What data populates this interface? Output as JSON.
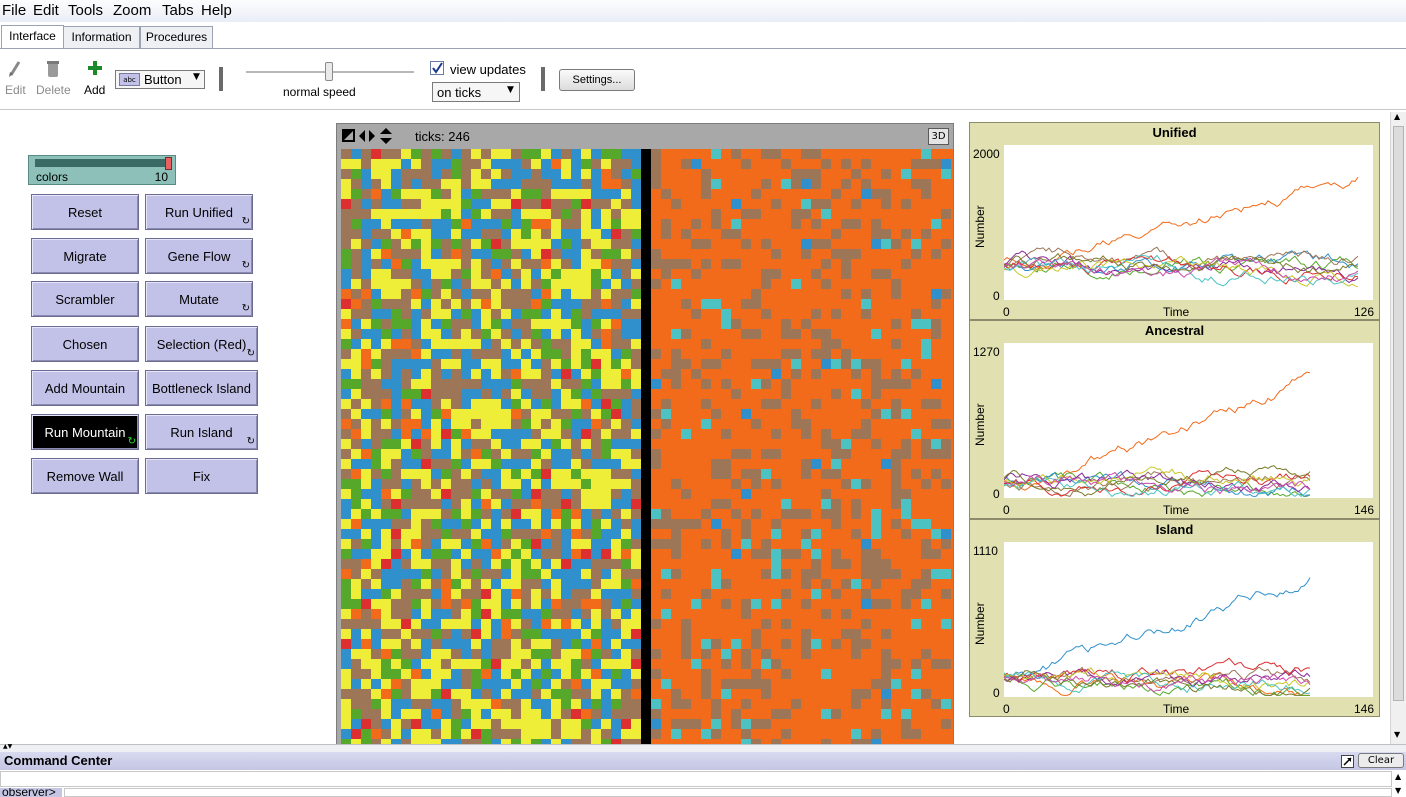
{
  "menu": [
    "File",
    "Edit",
    "Tools",
    "Zoom",
    "Tabs",
    "Help"
  ],
  "tabs": [
    "Interface",
    "Information",
    "Procedures"
  ],
  "toolbar": {
    "edit": "Edit",
    "delete": "Delete",
    "add": "Add",
    "widget_type": "Button",
    "speed_label": "normal speed",
    "view_updates": "view updates",
    "update_mode": "on ticks",
    "settings": "Settings..."
  },
  "slider": {
    "name": "colors",
    "value": "10",
    "fill": 1.0
  },
  "buttons": [
    {
      "label": "Reset",
      "forever": false
    },
    {
      "label": "Run Unified",
      "forever": true
    },
    {
      "label": "Migrate",
      "forever": false
    },
    {
      "label": "Gene Flow",
      "forever": true
    },
    {
      "label": "Scrambler",
      "forever": false
    },
    {
      "label": "Mutate",
      "forever": true
    },
    {
      "label": "Chosen",
      "forever": false
    },
    {
      "label": "Selection (Red)",
      "forever": true
    },
    {
      "label": "Add Mountain",
      "forever": false
    },
    {
      "label": "Bottleneck Island",
      "forever": false
    },
    {
      "label": "Run Mountain",
      "forever": true
    },
    {
      "label": "Run Island",
      "forever": true
    },
    {
      "label": "Remove Wall",
      "forever": false
    },
    {
      "label": "Fix",
      "forever": false
    }
  ],
  "world": {
    "ticks": "ticks: 246",
    "three_d": "3D"
  },
  "colors": {
    "orange": "#f26b1a",
    "brown": "#9c7656",
    "yellow": "#eeee38",
    "blue": "#2f90cc",
    "green": "#55a82a",
    "red": "#dd2f2f",
    "cyan": "#4cc2c2",
    "black": "#000000"
  },
  "plots": [
    {
      "title": "Unified",
      "ymax": "2000",
      "ymin": "0",
      "xmin": "0",
      "xmax": "126",
      "xlabel": "Time",
      "ylabel": "Number"
    },
    {
      "title": "Ancestral",
      "ymax": "1270",
      "ymin": "0",
      "xmin": "0",
      "xmax": "146",
      "xlabel": "Time",
      "ylabel": "Number"
    },
    {
      "title": "Island",
      "ymax": "1110",
      "ymin": "0",
      "xmin": "0",
      "xmax": "146",
      "xlabel": "Time",
      "ylabel": "Number"
    }
  ],
  "command_center": {
    "title": "Command Center",
    "clear": "Clear",
    "prompt": "observer>"
  }
}
